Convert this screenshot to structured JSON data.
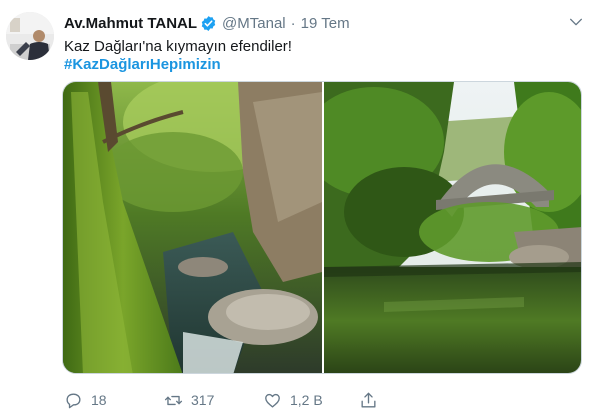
{
  "tweet": {
    "author_name": "Av.Mahmut TANAL",
    "handle": "@MTanal",
    "separator": "·",
    "time": "19 Tem",
    "text": "Kaz Dağları'na kıymayın efendiler!",
    "hashtag": "#KazDağlarıHepimizin"
  },
  "actions": {
    "reply_count": "18",
    "retweet_count": "317",
    "like_count": "1,2 B"
  },
  "icons": {
    "verified": "verified-badge-icon",
    "more": "chevron-down-icon",
    "reply": "reply-icon",
    "retweet": "retweet-icon",
    "like": "heart-icon",
    "share": "share-icon"
  },
  "colors": {
    "link": "#1b95e0",
    "verified": "#1da1f2",
    "muted": "#657786"
  }
}
